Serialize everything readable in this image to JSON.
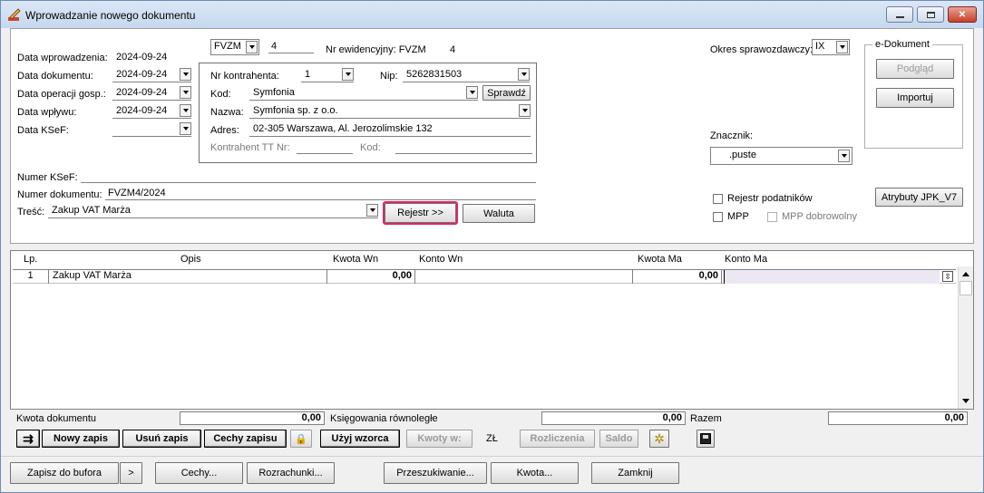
{
  "window": {
    "title": "Wprowadzanie nowego dokumentu"
  },
  "header": {
    "data_wprowadzenia_label": "Data wprowadzenia:",
    "data_wprowadzenia": "2024-09-24",
    "data_dokumentu_label": "Data dokumentu:",
    "data_dokumentu": "2024-09-24",
    "data_operacji_label": "Data operacji gosp.:",
    "data_operacji": "2024-09-24",
    "data_wplywu_label": "Data wpływu:",
    "data_wplywu": "2024-09-24",
    "data_ksef_label": "Data KSeF:",
    "data_ksef": "",
    "doc_type": "FVZM",
    "doc_no": "4",
    "nr_ewid_label": "Nr ewidencyjny: FVZM",
    "nr_ewid_value": "4"
  },
  "contractor": {
    "nr_label": "Nr kontrahenta:",
    "nr": "1",
    "nip_label": "Nip:",
    "nip": "5262831503",
    "kod_label": "Kod:",
    "kod": "Symfonia",
    "sprawdz_label": "Sprawdź",
    "nazwa_label": "Nazwa:",
    "nazwa": "Symfonia sp. z o.o.",
    "adres_label": "Adres:",
    "adres": "02-305 Warszawa, Al. Jerozolimskie 132",
    "tt_label": "Kontrahent TT Nr:",
    "tt_kod_label": "Kod:"
  },
  "document": {
    "numer_ksef_label": "Numer KSeF:",
    "numer_dok_label": "Numer dokumentu:",
    "numer_dok": "FVZM4/2024",
    "tresc_label": "Treść:",
    "tresc": "Zakup VAT Marża",
    "rejestr_label": "Rejestr >>",
    "waluta_label": "Waluta"
  },
  "right": {
    "okres_label": "Okres sprawozdawczy:",
    "okres": "IX",
    "edok_title": "e-Dokument",
    "podglad_label": "Podgląd",
    "importuj_label": "Importuj",
    "znacznik_label": "Znacznik:",
    "znacznik": ".puste",
    "atrybuty_label": "Atrybuty JPK_V7",
    "rejestr_podatnikow_label": "Rejestr podatników",
    "mpp_label": "MPP",
    "mpp_dobrowolny_label": "MPP dobrowolny"
  },
  "grid": {
    "headers": {
      "lp": "Lp.",
      "opis": "Opis",
      "kwota_wn": "Kwota  Wn",
      "konto_wn": "Konto  Wn",
      "kwota_ma": "Kwota Ma",
      "konto_ma": "Konto Ma"
    },
    "rows": [
      {
        "lp": "1",
        "opis": "Zakup VAT Marża",
        "kwota_wn": "0,00",
        "konto_wn": "",
        "kwota_ma": "0,00",
        "konto_ma": ""
      }
    ]
  },
  "summary": {
    "kwota_dok_label": "Kwota dokumentu",
    "kwota_dok": "0,00",
    "ksiegowania_label": "Księgowania równoległe",
    "ksiegowania": "0,00",
    "razem_label": "Razem",
    "razem": "0,00"
  },
  "toolbar": {
    "nowy_zapis": "Nowy zapis",
    "usun_zapis": "Usuń zapis",
    "cechy_zapisu": "Cechy zapisu",
    "uzyj_wzorca": "Użyj wzorca",
    "kwoty_w": "Kwoty w:",
    "currency": "ZŁ",
    "rozliczenia": "Rozliczenia",
    "saldo": "Saldo"
  },
  "bottom": {
    "zapisz": "Zapisz do bufora",
    "more": ">",
    "cechy": "Cechy...",
    "rozrachunki": "Rozrachunki...",
    "przeszukiwanie": "Przeszukiwanie...",
    "kwota": "Kwota...",
    "zamknij": "Zamknij"
  }
}
